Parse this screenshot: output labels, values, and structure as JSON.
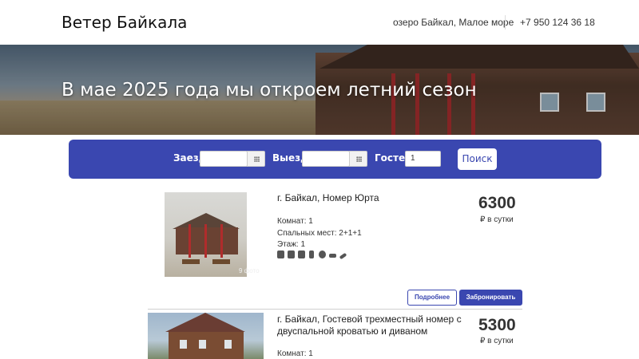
{
  "header": {
    "brand": "Ветер Байкала",
    "location": "озеро Байкал, Малое море",
    "phone": "+7 950 124 36 18"
  },
  "hero": {
    "title": "В мае 2025 года мы откроем летний сезон"
  },
  "search": {
    "checkin_label": "Заезд",
    "checkin_value": "",
    "checkout_label": "Выезд",
    "checkout_value": "",
    "guests_label": "Гостей",
    "guests_value": "1",
    "submit_label": "Поиск"
  },
  "rooms": [
    {
      "title": "г. Байкал, Номер Юрта",
      "rooms": "Комнат: 1",
      "beds": "Спальных мест: 2+1+1",
      "floor": "Этаж: 1",
      "photo_count": "9 фото",
      "price": "6300",
      "per_night": "₽ в сутки",
      "more_label": "Подробнее",
      "book_label": "Забронировать",
      "amenity_icons": [
        "wifi-icon",
        "tv-icon",
        "kettle-icon",
        "fridge-icon",
        "parking-icon",
        "hairdryer-icon",
        "iron-icon"
      ]
    },
    {
      "title_line1": "г. Байкал, Гостевой трехместный номер с",
      "title_line2": "двуспальной кроватью и диваном",
      "rooms": "Комнат: 1",
      "price": "5300",
      "per_night": "₽ в сутки"
    }
  ],
  "colors": {
    "accent": "#3a47b0",
    "text": "#222222",
    "background": "#ffffff"
  }
}
